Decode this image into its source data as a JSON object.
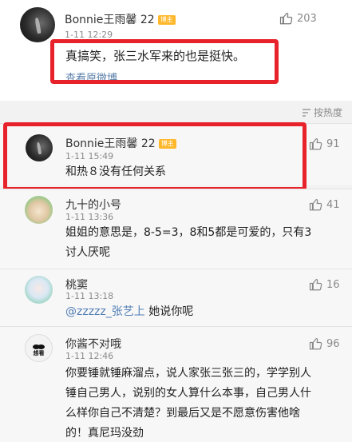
{
  "top_post": {
    "author": "Bonnie王雨馨 22",
    "badge": "博主",
    "time": "1-11 12:29",
    "likes": "203",
    "text": "真搞笑，张三水军来的也是挺快。",
    "link": "查看原微博"
  },
  "sort_label": "按热度",
  "comments": [
    {
      "author": "Bonnie王雨馨 22",
      "badge": "博主",
      "time": "1-11 15:49",
      "likes": "91",
      "text": "和热８没有任何关系"
    },
    {
      "author": "九十的小号",
      "time": "1-11 13:36",
      "likes": "41",
      "text_lines": [
        "姐姐的意思是，8-5=3，8和5都是可爱的，只有3",
        "讨人厌呢"
      ]
    },
    {
      "author": "桃窦",
      "time": "1-11 13:18",
      "likes": "16",
      "mention": "@zzzzz_张艺上",
      "text": "她说你呢"
    },
    {
      "author": "你酱不对哦",
      "time": "1-11 12:46",
      "likes": "96",
      "avatar_caption": "想看",
      "text_lines": [
        "你要锤就锤麻溜点，说人家张三张三的，学学别人",
        "锤自己男人，说别的女人算什么本事，自己男人什",
        "么样你自己不清楚？到最后又是不愿意伤害他啥",
        "的！真尼玛没劲"
      ]
    }
  ]
}
